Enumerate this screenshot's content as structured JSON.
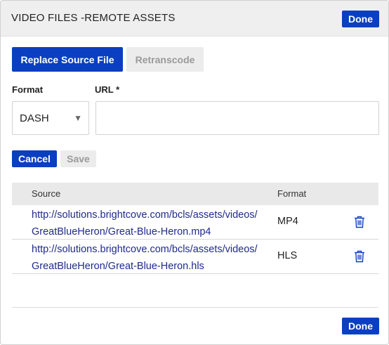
{
  "header": {
    "title": "VIDEO FILES -REMOTE ASSETS",
    "done_label": "Done"
  },
  "actions": {
    "replace_label": "Replace Source File",
    "retranscode_label": "Retranscode"
  },
  "form": {
    "format_label": "Format",
    "format_value": "DASH",
    "url_label": "URL *",
    "url_value": "",
    "cancel_label": "Cancel",
    "save_label": "Save"
  },
  "table": {
    "headers": {
      "source": "Source",
      "format": "Format"
    },
    "rows": [
      {
        "source": "http://solutions.brightcove.com/bcls/assets/videos/GreatBlueHeron/Great-Blue-Heron.mp4",
        "format": "MP4"
      },
      {
        "source": "http://solutions.brightcove.com/bcls/assets/videos/GreatBlueHeron/Great-Blue-Heron.hls",
        "format": "HLS"
      }
    ]
  },
  "footer": {
    "done_label": "Done"
  },
  "icons": {
    "caret": "caret-down-icon",
    "delete": "trash-icon"
  },
  "colors": {
    "primary": "#0a3fc2",
    "link": "#1f2a8c",
    "header_bg": "#efefef"
  }
}
